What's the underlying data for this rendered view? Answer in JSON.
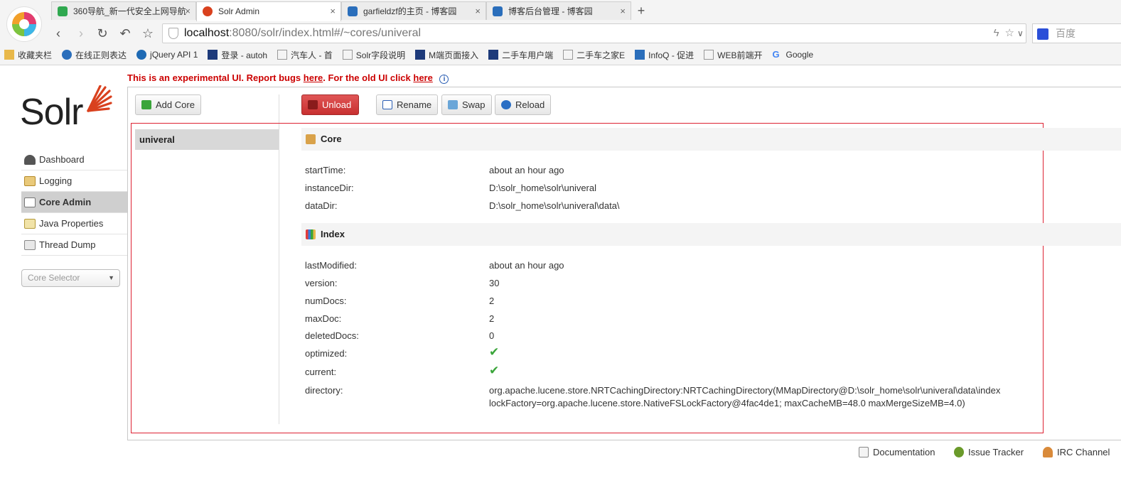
{
  "browser": {
    "tabs": [
      {
        "label": "360导航_新一代安全上网导航",
        "active": false
      },
      {
        "label": "Solr Admin",
        "active": true
      },
      {
        "label": "garfieldzf的主页 - 博客园",
        "active": false
      },
      {
        "label": "博客后台管理 - 博客园",
        "active": false
      }
    ],
    "new_tab": "+",
    "tab_close": "×",
    "url_host": "localhost",
    "url_rest": ":8080/solr/index.html#/~cores/univeral",
    "search_placeholder": "百度",
    "bookmarks": [
      "收藏夹栏",
      "在线正则表达",
      "jQuery API 1",
      "登录 - autoh",
      "汽车人 - 首",
      "Solr字段说明",
      "M端页面接入",
      "二手车用户端",
      "二手车之家E",
      "InfoQ - 促进",
      "WEB前端开",
      "Google"
    ]
  },
  "banner": {
    "prefix": "This is an experimental UI. Report bugs ",
    "link1": "here",
    "middle": ". For the old UI click ",
    "link2": "here",
    "info": "i"
  },
  "logo": {
    "text": "Solr"
  },
  "nav": {
    "items": [
      {
        "label": "Dashboard"
      },
      {
        "label": "Logging"
      },
      {
        "label": "Core Admin"
      },
      {
        "label": "Java Properties"
      },
      {
        "label": "Thread Dump"
      }
    ],
    "core_selector": "Core Selector"
  },
  "toolbar": {
    "add_core": "Add Core",
    "unload": "Unload",
    "rename": "Rename",
    "swap": "Swap",
    "reload": "Reload"
  },
  "core_list": [
    "univeral"
  ],
  "core_section": {
    "title": "Core",
    "props": [
      {
        "label": "startTime:",
        "value": "about an hour ago"
      },
      {
        "label": "instanceDir:",
        "value": "D:\\solr_home\\solr\\univeral"
      },
      {
        "label": "dataDir:",
        "value": "D:\\solr_home\\solr\\univeral\\data\\"
      }
    ]
  },
  "index_section": {
    "title": "Index",
    "props": [
      {
        "label": "lastModified:",
        "value": "about an hour ago"
      },
      {
        "label": "version:",
        "value": "30"
      },
      {
        "label": "numDocs:",
        "value": "2"
      },
      {
        "label": "maxDoc:",
        "value": "2"
      },
      {
        "label": "deletedDocs:",
        "value": "0"
      },
      {
        "label": "optimized:",
        "value": "✔"
      },
      {
        "label": "current:",
        "value": "✔"
      },
      {
        "label": "directory:",
        "value": "org.apache.lucene.store.NRTCachingDirectory:NRTCachingDirectory(MMapDirectory@D:\\solr_home\\solr\\univeral\\data\\index lockFactory=org.apache.lucene.store.NativeFSLockFactory@4fac4de1; maxCacheMB=48.0 maxMergeSizeMB=4.0)"
      }
    ]
  },
  "footer": {
    "documentation": "Documentation",
    "issue_tracker": "Issue Tracker",
    "irc_channel": "IRC Channel"
  },
  "colors": {
    "banner_red": "#cc0000",
    "unload_red": "#c83030",
    "highlight_box": "#dd2233",
    "check_green": "#3aa53a"
  }
}
